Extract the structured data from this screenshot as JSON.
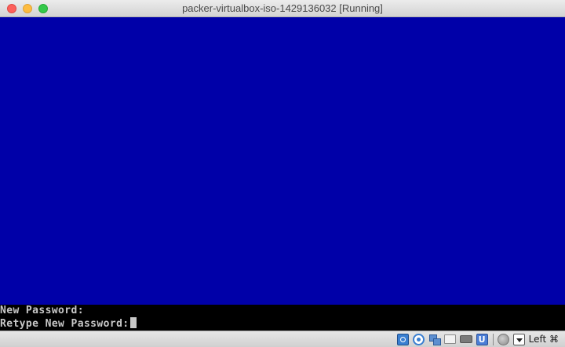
{
  "window": {
    "title": "packer-virtualbox-iso-1429136032 [Running]",
    "colors": {
      "screen_background": "#0000a8",
      "console_background": "#000000",
      "console_text": "#c8c8c8"
    }
  },
  "console": {
    "line1": "New Password:",
    "line2": "Retype New Password:"
  },
  "statusbar": {
    "icons": [
      "hard-disk-icon",
      "optical-drive-icon",
      "network-icon",
      "shared-folders-icon",
      "usb-device-icon",
      "usb-icon",
      "mouse-integration-icon",
      "keyboard-capture-icon"
    ],
    "host_key": "Left ⌘"
  }
}
